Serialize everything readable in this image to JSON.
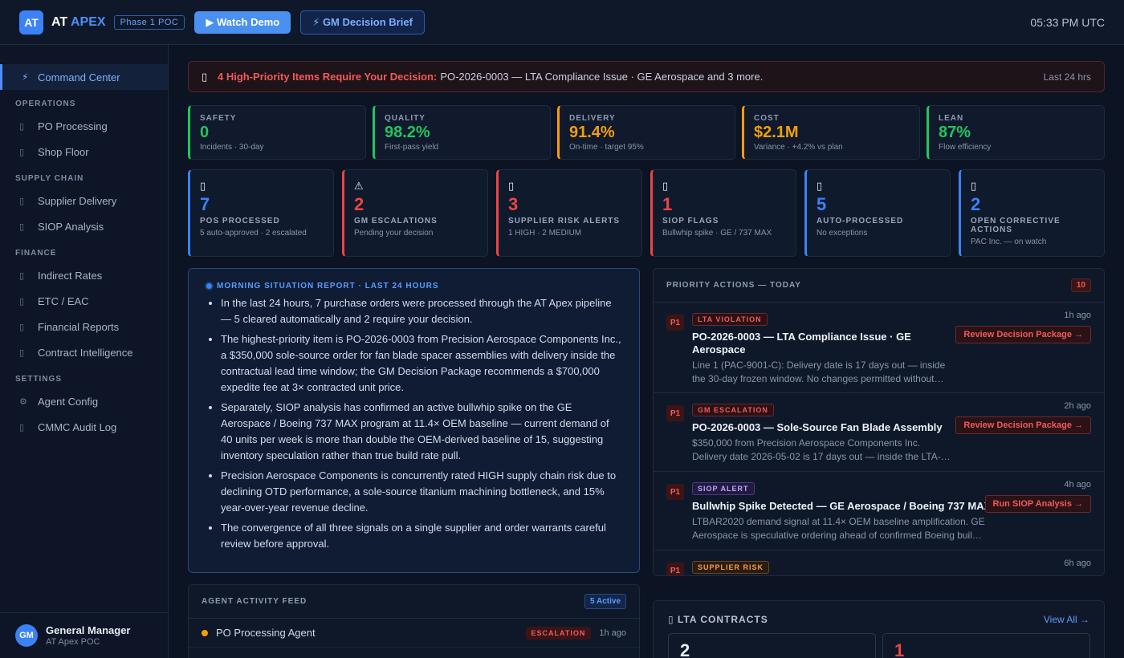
{
  "header": {
    "logo": "AT",
    "brand_prefix": "AT",
    "brand_accent": "APEX",
    "phase_badge": "Phase 1 POC",
    "watch_demo": "▶ Watch Demo",
    "decision_brief": "⚡ GM Decision Brief",
    "time": "05:33 PM UTC"
  },
  "sidebar": {
    "active": {
      "icon": "⚡",
      "label": "Command Center"
    },
    "sections": [
      {
        "title": "OPERATIONS",
        "items": [
          {
            "icon": "▯",
            "label": "PO Processing"
          },
          {
            "icon": "▯",
            "label": "Shop Floor"
          }
        ]
      },
      {
        "title": "SUPPLY CHAIN",
        "items": [
          {
            "icon": "▯",
            "label": "Supplier Delivery"
          },
          {
            "icon": "▯",
            "label": "SIOP Analysis"
          }
        ]
      },
      {
        "title": "FINANCE",
        "items": [
          {
            "icon": "▯",
            "label": "Indirect Rates"
          },
          {
            "icon": "▯",
            "label": "ETC / EAC"
          },
          {
            "icon": "▯",
            "label": "Financial Reports"
          },
          {
            "icon": "▯",
            "label": "Contract Intelligence"
          }
        ]
      },
      {
        "title": "SETTINGS",
        "items": [
          {
            "icon": "⚙",
            "label": "Agent Config"
          },
          {
            "icon": "▯",
            "label": "CMMC Audit Log"
          }
        ]
      }
    ],
    "user": {
      "initials": "GM",
      "name": "General Manager",
      "role": "AT Apex POC"
    }
  },
  "alert": {
    "icon": "▯",
    "highlight": "4 High-Priority Items Require Your Decision:",
    "message": "PO-2026-0003 — LTA Compliance Issue · GE Aerospace and 3 more.",
    "time": "Last 24 hrs"
  },
  "kpis": [
    {
      "label": "SAFETY",
      "value": "0",
      "sub": "Incidents · 30-day",
      "color": "#22c55e"
    },
    {
      "label": "QUALITY",
      "value": "98.2%",
      "sub": "First-pass yield",
      "color": "#22c55e"
    },
    {
      "label": "DELIVERY",
      "value": "91.4%",
      "sub": "On-time · target 95%",
      "color": "#f59e0b"
    },
    {
      "label": "COST",
      "value": "$2.1M",
      "sub": "Variance · +4.2% vs plan",
      "color": "#f59e0b"
    },
    {
      "label": "LEAN",
      "value": "87%",
      "sub": "Flow efficiency",
      "color": "#22c55e"
    }
  ],
  "cards": [
    {
      "icon": "▯",
      "value": "7",
      "label": "POS PROCESSED",
      "sub": "5 auto-approved · 2 escalated",
      "color": "#3b82f6"
    },
    {
      "icon": "⚠",
      "value": "2",
      "label": "GM ESCALATIONS",
      "sub": "Pending your decision",
      "color": "#ef4444"
    },
    {
      "icon": "▯",
      "value": "3",
      "label": "SUPPLIER RISK ALERTS",
      "sub": "1 HIGH · 2 MEDIUM",
      "color": "#ef4444"
    },
    {
      "icon": "▯",
      "value": "1",
      "label": "SIOP FLAGS",
      "sub": "Bullwhip spike · GE / 737 MAX",
      "color": "#ef4444"
    },
    {
      "icon": "▯",
      "value": "5",
      "label": "AUTO-PROCESSED",
      "sub": "No exceptions",
      "color": "#3b82f6"
    },
    {
      "icon": "▯",
      "value": "2",
      "label": "OPEN CORRECTIVE ACTIONS",
      "sub": "PAC Inc. — on watch",
      "color": "#3b82f6"
    }
  ],
  "report": {
    "title": "MORNING SITUATION REPORT · LAST 24 HOURS",
    "bullets": [
      "In the last 24 hours, 7 purchase orders were processed through the AT Apex pipeline — 5 cleared automatically and 2 require your decision.",
      "The highest-priority item is PO-2026-0003 from Precision Aerospace Components Inc., a $350,000 sole-source order for fan blade spacer assemblies with delivery inside the contractual lead time window; the GM Decision Package recommends a $700,000 expedite fee at 3× contracted unit price.",
      "Separately, SIOP analysis has confirmed an active bullwhip spike on the GE Aerospace / Boeing 737 MAX program at 11.4× OEM baseline — current demand of 40 units per week is more than double the OEM-derived baseline of 15, suggesting inventory speculation rather than true build rate pull.",
      "Precision Aerospace Components is concurrently rated HIGH supply chain risk due to declining OTD performance, a sole-source titanium machining bottleneck, and 15% year-over-year revenue decline.",
      "The convergence of all three signals on a single supplier and order warrants careful review before approval."
    ]
  },
  "priority": {
    "title": "PRIORITY ACTIONS — TODAY",
    "count": "10",
    "items": [
      {
        "p": "P1",
        "tag": "LTA VIOLATION",
        "tag_style": "red",
        "title": "PO-2026-0003 — LTA Compliance Issue · GE Aerospace",
        "desc": "Line 1 (PAC-9001-C): Delivery date is 17 days out — inside the 30-day frozen window. No changes permitted without approval.",
        "time": "1h ago",
        "action": "Review Decision Package →"
      },
      {
        "p": "P1",
        "tag": "GM ESCALATION",
        "tag_style": "red",
        "title": "PO-2026-0003 — Sole-Source Fan Blade Assembly",
        "desc": "$350,000 from Precision Aerospace Components Inc. Delivery date 2026-05-02 is 17 days out — inside the LTA-defined lead time.",
        "time": "2h ago",
        "action": "Review Decision Package →"
      },
      {
        "p": "P1",
        "tag": "SIOP ALERT",
        "tag_style": "purple",
        "title": "Bullwhip Spike Detected — GE Aerospace / Boeing 737 MAX",
        "desc": "LTBAR2020 demand signal at 11.4× OEM baseline amplification. GE Aerospace is speculative ordering ahead of confirmed Boeing build rates.",
        "time": "4h ago",
        "action": "Run SIOP Analysis →"
      },
      {
        "p": "P1",
        "tag": "SUPPLIER RISK",
        "tag_style": "orange",
        "title": "",
        "desc": "",
        "time": "6h ago",
        "action": ""
      }
    ]
  },
  "feed": {
    "title": "AGENT ACTIVITY FEED",
    "badge": "5 Active",
    "rows": [
      {
        "name": "PO Processing Agent",
        "status": "ESCALATION",
        "time": "1h ago"
      }
    ]
  },
  "lta": {
    "title": "▯ LTA CONTRACTS",
    "view_all": "View All →",
    "boxes": [
      {
        "value": "2",
        "color": "#e6edf7"
      },
      {
        "value": "1",
        "color": "#ef4444"
      }
    ]
  }
}
